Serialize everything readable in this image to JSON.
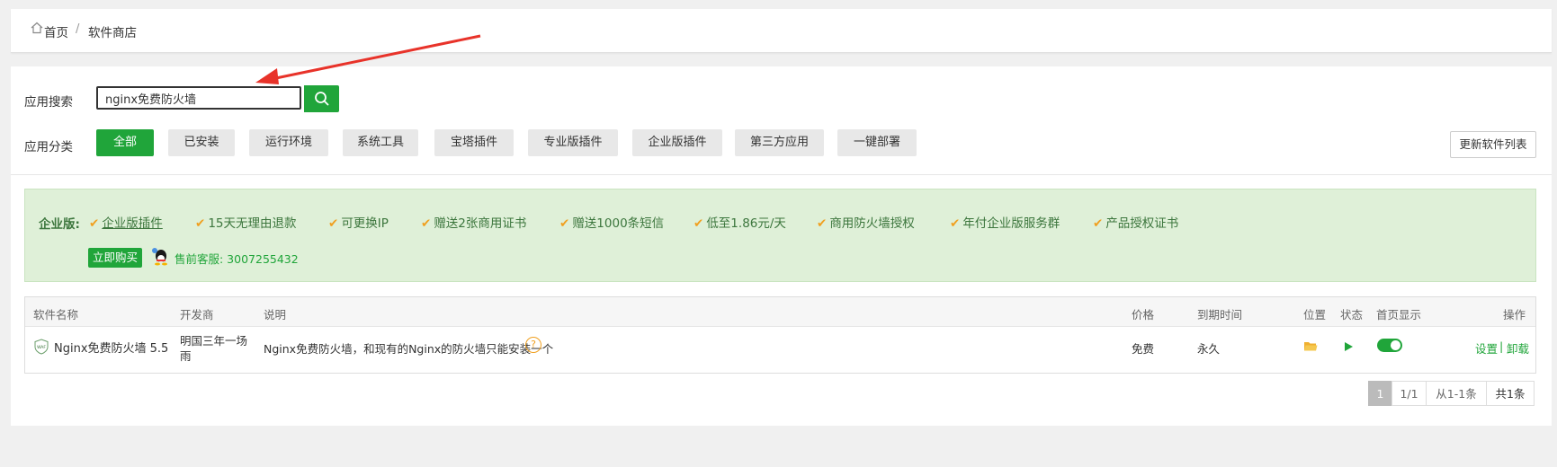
{
  "breadcrumb": {
    "home": "首页",
    "separator": "/",
    "current": "软件商店"
  },
  "search": {
    "label": "应用搜索",
    "value": "nginx免费防火墙",
    "placeholder": ""
  },
  "category": {
    "label": "应用分类",
    "items": [
      "全部",
      "已安装",
      "运行环境",
      "系统工具",
      "宝塔插件",
      "专业版插件",
      "企业版插件",
      "第三方应用",
      "一键部署"
    ],
    "active_index": 0
  },
  "refresh_label": "更新软件列表",
  "promo": {
    "lead": "企业版:",
    "features": [
      "企业版插件",
      "15天无理由退款",
      "可更换IP",
      "赠送2张商用证书",
      "赠送1000条短信",
      "低至1.86元/天",
      "商用防火墙授权",
      "年付企业版服务群",
      "产品授权证书"
    ],
    "buy_label": "立即购买",
    "sales_contact": "售前客服: 3007255432"
  },
  "table": {
    "headers": [
      "软件名称",
      "开发商",
      "说明",
      "价格",
      "到期时间",
      "位置",
      "状态",
      "首页显示",
      "操作"
    ],
    "rows": [
      {
        "name": "Nginx免费防火墙 5.5",
        "developer_line1": "明国三年一场",
        "developer_line2": "雨",
        "description": "Nginx免费防火墙，和现有的Nginx的防火墙只能安装一个",
        "help": "?",
        "price": "免费",
        "expiry": "永久",
        "action_settings": "设置",
        "action_sep": "|",
        "action_uninstall": "卸载",
        "homepage_display": true
      }
    ]
  },
  "pagination": {
    "current": "1",
    "pages": "1/1",
    "range": "从1-1条",
    "total": "共1条"
  },
  "colors": {
    "accent": "#20a53a",
    "promo_bg": "#dff0d8",
    "check": "#f0a020",
    "arrow": "#e8332a"
  }
}
